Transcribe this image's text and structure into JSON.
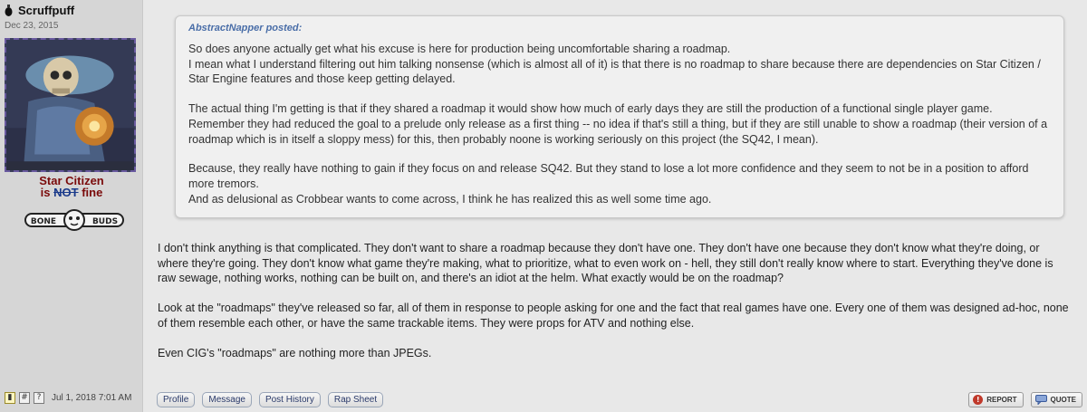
{
  "user": {
    "name": "Scruffpuff",
    "joined": "Dec 23, 2015",
    "icon": "grenade-icon",
    "title_line1": "Star Citizen",
    "title_is": "is",
    "title_not": "NOT",
    "title_fine": "fine",
    "badge_text": "BONE BUDS"
  },
  "quote": {
    "author": "AbstractNapper posted:",
    "paragraphs": [
      "So does anyone actually get what his excuse is here for production being uncomfortable sharing a roadmap.",
      "I mean what I understand filtering out him talking nonsense (which is almost all of it) is that there is no roadmap to share because there are dependencies on Star Citizen / Star Engine features and those keep getting delayed.",
      "The actual thing I'm getting is that if they shared a roadmap it would show how much of early days they are still the production of a functional single player game. Remember they had reduced the goal to a prelude only release as a first thing -- no idea if that's still a thing, but if they are still unable to show a roadmap (their version of a roadmap which is in itself a sloppy mess) for this, then probably noone is working seriously on this project (the SQ42, I mean).",
      "Because, they really have nothing to gain if they focus on and release SQ42. But they stand to lose a lot more confidence and they seem to not be in a position to afford more tremors.",
      "And as delusional as Crobbear wants to come across, I think he has realized this as well some time ago."
    ]
  },
  "post": {
    "paragraphs": [
      "I don't think anything is that complicated. They don't want to share a roadmap because they don't have one. They don't have one because they don't know what they're doing, or where they're going. They don't know what game they're making, what to prioritize, what to even work on - hell, they still don't really know where to start. Everything they've done is raw sewage, nothing works, nothing can be built on, and there's an idiot at the helm. What exactly would be on the roadmap?",
      "Look at the \"roadmaps\" they've released so far, all of them in response to people asking for one and the fact that real games have one. Every one of them was designed ad-hoc, none of them resemble each other, or have the same trackable items. They were props for ATV and nothing else.",
      "Even CIG's \"roadmaps\" are nothing more than JPEGs."
    ]
  },
  "meta": {
    "icons": [
      "note-icon",
      "permalink-icon",
      "help-icon"
    ],
    "permalink_glyph": "#",
    "help_glyph": "?",
    "timestamp": "Jul 1, 2018 7:01 AM"
  },
  "actions": {
    "profile": "Profile",
    "message": "Message",
    "post_history": "Post History",
    "rap_sheet": "Rap Sheet",
    "report": "REPORT",
    "quote": "QUOTE"
  },
  "colors": {
    "background": "#e8e8e8",
    "sidebar": "#d6d6d6",
    "quote_author": "#4a6ea8",
    "title_red": "#7a0a0a",
    "title_not_blue": "#1a3a8a"
  }
}
